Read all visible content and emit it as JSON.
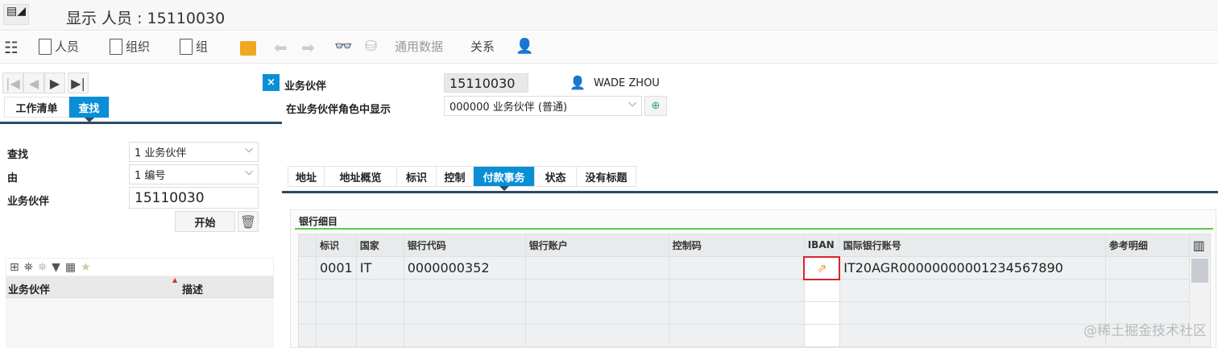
{
  "window": {
    "title": "显示 人员 : 15110030"
  },
  "toolbar": {
    "person": "人员",
    "org": "组织",
    "group": "组",
    "general_data": "通用数据",
    "relations": "关系"
  },
  "left": {
    "tabs": [
      "工作清单",
      "查找"
    ],
    "search_label": "查找",
    "search_value": "1 业务伙伴",
    "by_label": "由",
    "by_value": "1 编号",
    "bp_label": "业务伙伴",
    "bp_value": "15110030",
    "start_button": "开始",
    "list_columns": [
      "业务伙伴",
      "描述"
    ]
  },
  "header": {
    "bp_label": "业务伙伴",
    "bp_value": "15110030",
    "user_name": "WADE ZHOU",
    "role_label": "在业务伙伴角色中显示",
    "role_value": "000000 业务伙伴 (普通)"
  },
  "tabs": [
    "地址",
    "地址概览",
    "标识",
    "控制",
    "付款事务",
    "状态",
    "没有标题"
  ],
  "bank": {
    "title": "银行细目",
    "columns": [
      "标识",
      "国家",
      "银行代码",
      "银行账户",
      "控制码",
      "IBAN",
      "国际银行账号",
      "参考明细"
    ],
    "rows": [
      {
        "id": "0001",
        "country": "IT",
        "bank_code": "0000000352",
        "account": "",
        "control": "",
        "iban_btn": "",
        "iban": "IT20AGR00000000001234567890",
        "ref": ""
      }
    ]
  },
  "watermark": "@稀土掘金技术社区",
  "colors": {
    "accent": "#0a8fd6",
    "highlight": "#d9232d",
    "group_line": "#5ec94a"
  }
}
